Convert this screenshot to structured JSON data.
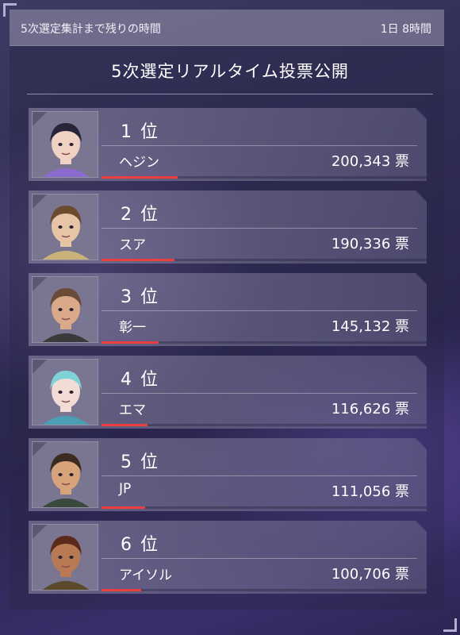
{
  "header": {
    "countdown_label": "5次選定集計まで残りの時間",
    "remaining_time": "1日 8時間"
  },
  "title": "5次選定リアルタイム投票公開",
  "ranking": [
    {
      "rank": "1 位",
      "name": "ヘジン",
      "votes": "200,343 票",
      "vote_count": 200343,
      "icon": "character-portrait-hejin",
      "accent": "#e8403f"
    },
    {
      "rank": "2 位",
      "name": "スア",
      "votes": "190,336 票",
      "vote_count": 190336,
      "icon": "character-portrait-sua",
      "accent": "#e8403f"
    },
    {
      "rank": "3 位",
      "name": "彰一",
      "votes": "145,132 票",
      "vote_count": 145132,
      "icon": "character-portrait-shoichi",
      "accent": "#e8403f"
    },
    {
      "rank": "4 位",
      "name": "エマ",
      "votes": "116,626 票",
      "vote_count": 116626,
      "icon": "character-portrait-emma",
      "accent": "#e8403f"
    },
    {
      "rank": "5 位",
      "name": "JP",
      "votes": "111,056 票",
      "vote_count": 111056,
      "icon": "character-portrait-jp",
      "accent": "#e8403f"
    },
    {
      "rank": "6 位",
      "name": "アイソル",
      "votes": "100,706 票",
      "vote_count": 100706,
      "icon": "character-portrait-aisol",
      "accent": "#e8403f"
    }
  ]
}
